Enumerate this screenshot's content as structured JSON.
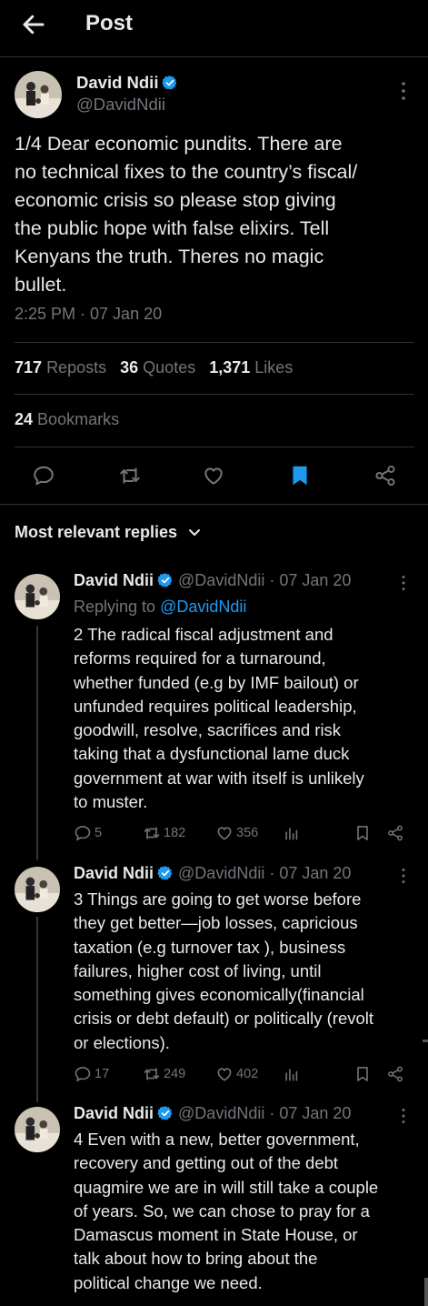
{
  "header": {
    "title": "Post"
  },
  "post": {
    "author_name": "David Ndii",
    "author_handle": "@DavidNdii",
    "text_lines": [
      "1/4 Dear economic pundits. There are",
      "no technical fixes to the country’s fiscal/",
      "economic crisis so please stop giving",
      "the public hope with false elixirs. Tell",
      "Kenyans the truth. Theres no magic",
      "bullet."
    ],
    "time": "2:25 PM · 07 Jan 20",
    "reposts_count": "717",
    "reposts_label": "Reposts",
    "quotes_count": "36",
    "quotes_label": "Quotes",
    "likes_count": "1,371",
    "likes_label": "Likes",
    "bookmarks_count": "24",
    "bookmarks_label": "Bookmarks"
  },
  "replies_filter": {
    "label": "Most relevant replies"
  },
  "replies": [
    {
      "name": "David Ndii",
      "handle": "@DavidNdii",
      "date": "· 07 Jan 20",
      "replying_prefix": "Replying to",
      "replying_handle": "@DavidNdii",
      "text_lines": [
        "2 The radical fiscal adjustment and",
        "reforms required for a turnaround,",
        "whether funded (e.g by IMF bailout) or",
        "unfunded requires political leadership,",
        "goodwill, resolve, sacrifices and risk",
        "taking that a dysfunctional lame duck",
        "government at war with itself is unlikely",
        "to muster."
      ],
      "replies": "5",
      "reposts": "182",
      "likes": "356"
    },
    {
      "name": "David Ndii",
      "handle": "@DavidNdii",
      "date": "· 07 Jan 20",
      "text_lines": [
        "3 Things are going to get worse before",
        "they get better—job losses, capricious",
        "taxation (e.g turnover tax ), business",
        "failures, higher cost of living, until",
        "something gives economically(financial",
        "crisis or debt default) or politically (revolt",
        "or elections)."
      ],
      "replies": "17",
      "reposts": "249",
      "likes": "402"
    },
    {
      "name": "David Ndii",
      "handle": "@DavidNdii",
      "date": "· 07 Jan 20",
      "text_lines": [
        "4 Even with a new, better government,",
        "recovery and getting out of the debt",
        "quagmire we are in will still take a couple",
        "of years. So, we can chose to pray for a",
        "Damascus moment in State House, or",
        "talk about how to bring about the",
        "political change we need."
      ]
    }
  ],
  "colors": {
    "accent": "#1d9bf0",
    "muted": "#71767b",
    "text": "#e7e9ea",
    "background": "#000000",
    "divider": "#2f3336"
  },
  "icons": [
    "back-arrow-icon",
    "verified-badge-icon",
    "more-options-icon",
    "reply-icon",
    "repost-icon",
    "like-icon",
    "bookmark-icon",
    "share-icon",
    "views-icon",
    "chevron-down-icon"
  ]
}
